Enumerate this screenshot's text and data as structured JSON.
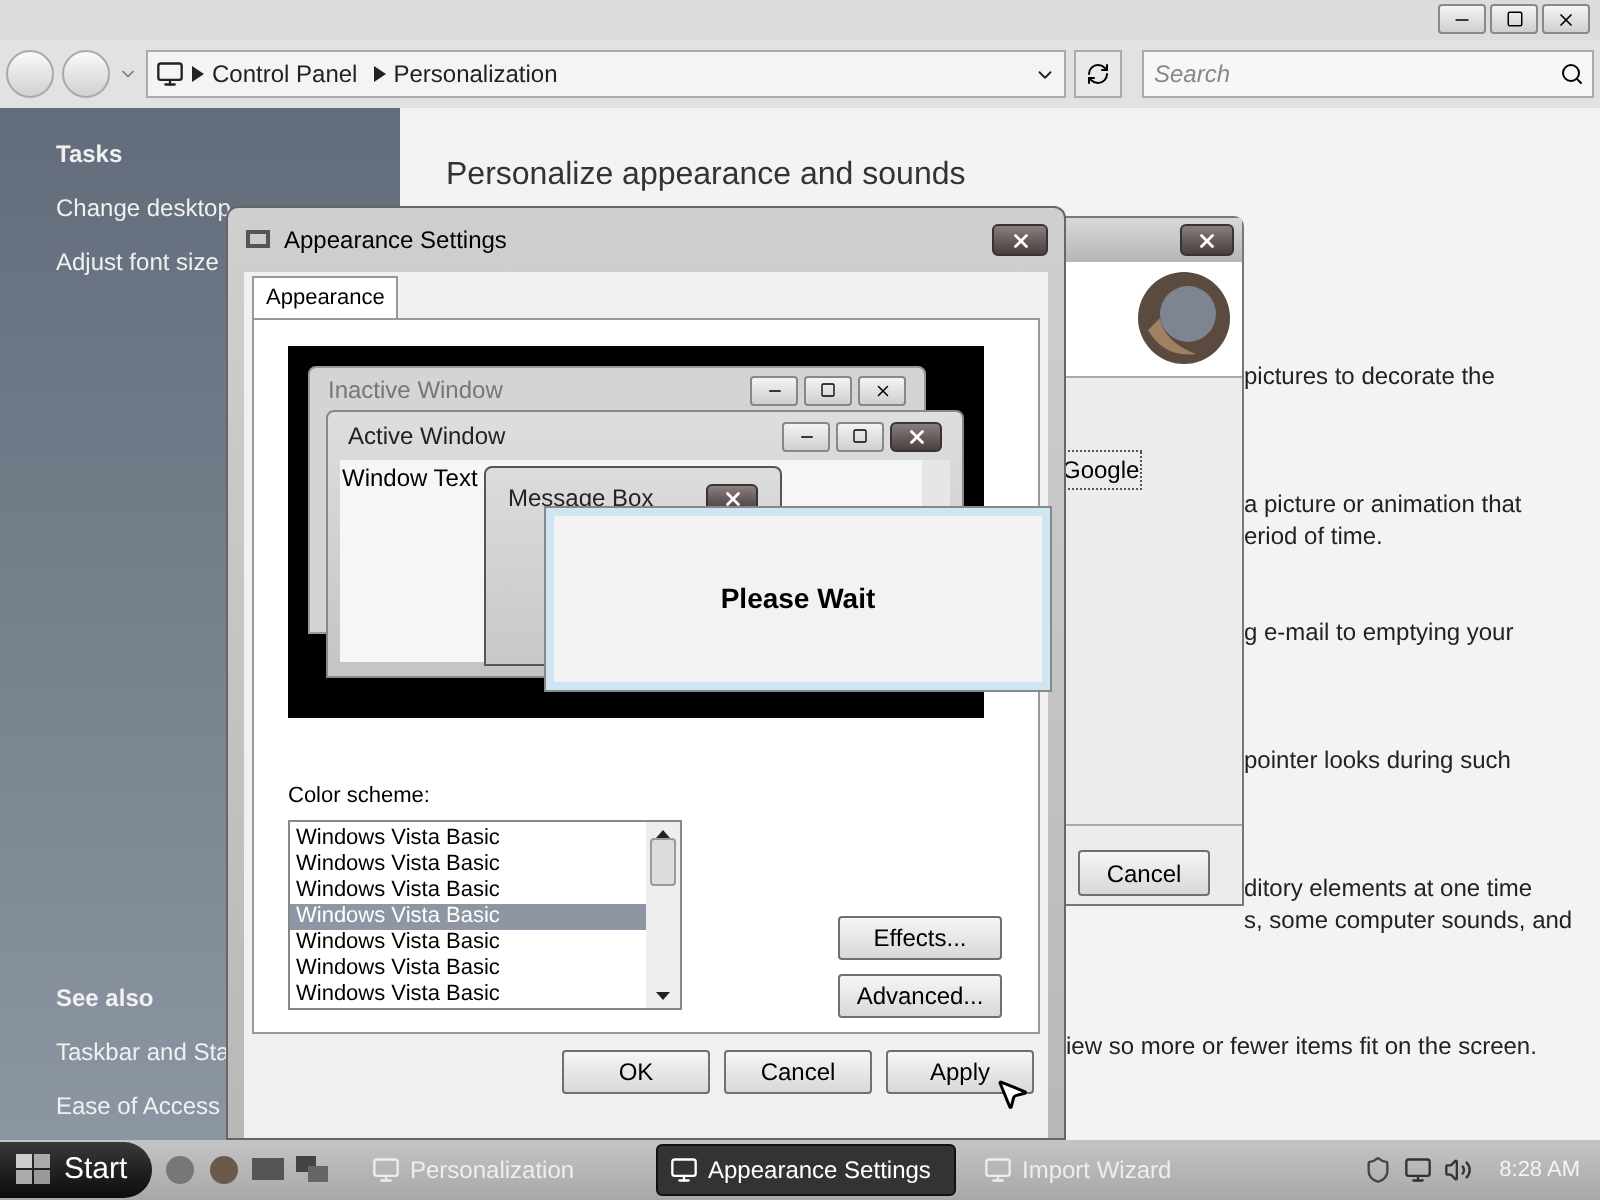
{
  "explorer": {
    "breadcrumbs": [
      "Control Panel",
      "Personalization"
    ],
    "search": {
      "placeholder": "Search"
    },
    "tasks_heading": "Tasks",
    "tasks": [
      "Change desktop",
      "Adjust font size"
    ],
    "see_also_heading": "See also",
    "see_also": [
      "Taskbar and Sta",
      "Ease of Access"
    ],
    "heading": "Personalize appearance and sounds",
    "paragraphs": [
      [
        "pictures to decorate the"
      ],
      [
        "a picture or animation that",
        "eriod of time."
      ],
      [
        "g e-mail to emptying your"
      ],
      [
        "pointer looks during such"
      ],
      [
        "ditory elements at one time",
        "s, some computer sounds, and"
      ],
      [
        "iew so more or fewer items fit on the screen."
      ]
    ]
  },
  "import_wizard": {
    "link": "Google",
    "buttons": [
      "Cancel"
    ]
  },
  "appearance_dialog": {
    "title": "Appearance Settings",
    "tabs": [
      {
        "label": "Appearance",
        "selected": true
      }
    ],
    "preview": {
      "inactive_title": "Inactive Window",
      "active_title": "Active Window",
      "window_text": "Window Text",
      "message_box_title": "Message Box"
    },
    "color_scheme_label": "Color scheme:",
    "color_schemes": [
      {
        "label": "Windows Vista Basic",
        "selected": false
      },
      {
        "label": "Windows Vista Basic",
        "selected": false
      },
      {
        "label": "Windows Vista Basic",
        "selected": false
      },
      {
        "label": "Windows Vista Basic",
        "selected": true
      },
      {
        "label": "Windows Vista Basic",
        "selected": false
      },
      {
        "label": "Windows Vista Basic",
        "selected": false
      },
      {
        "label": "Windows Vista Basic",
        "selected": false
      }
    ],
    "side_buttons": [
      "Effects...",
      "Advanced..."
    ],
    "buttons": [
      "OK",
      "Cancel",
      "Apply"
    ]
  },
  "please_wait": {
    "message": "Please Wait"
  },
  "taskbar": {
    "start": "Start",
    "tasks": [
      {
        "label": "Personalization",
        "selected": false
      },
      {
        "label": "Appearance Settings",
        "selected": true
      },
      {
        "label": "Import Wizard",
        "selected": false
      }
    ],
    "clock": "8:28 AM"
  }
}
